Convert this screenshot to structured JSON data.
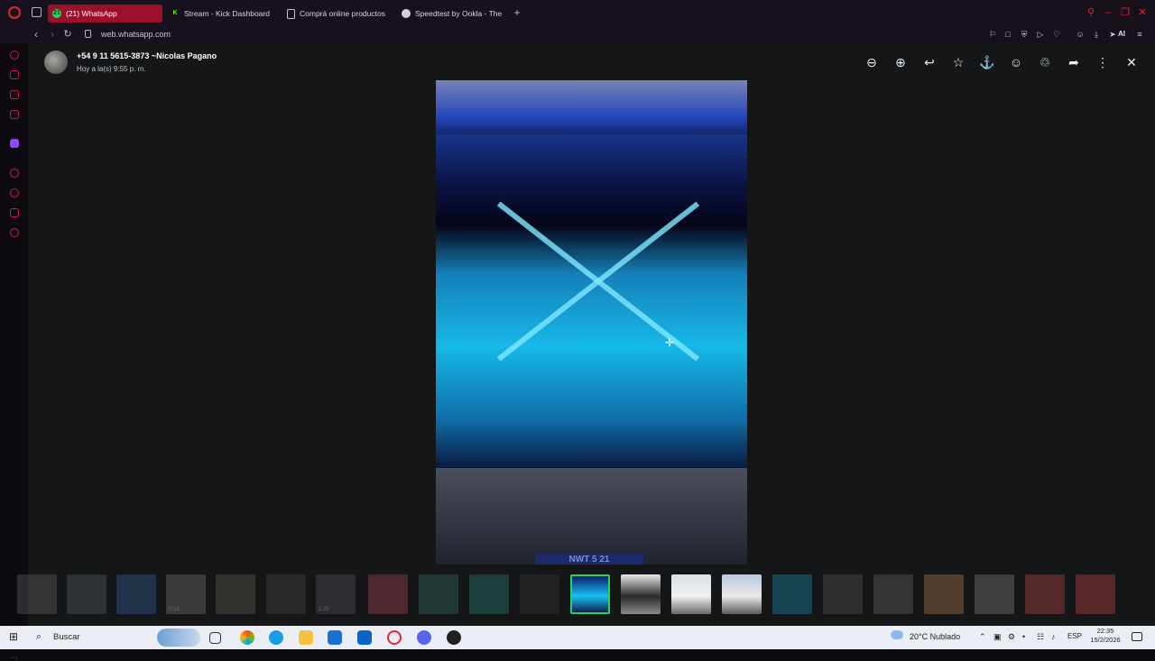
{
  "browser": {
    "tabs": [
      {
        "label": "(21) WhatsApp",
        "icon": "whatsapp-icon",
        "badge": "21",
        "active": true
      },
      {
        "label": "Stream - Kick Dashboard",
        "icon": "kick-icon",
        "active": false
      },
      {
        "label": "Comprá online productos",
        "icon": "page-icon",
        "active": false
      },
      {
        "label": "Speedtest by Ookla - The",
        "icon": "github-icon",
        "active": false
      }
    ],
    "new_tab": "+",
    "url": "web.whatsapp.com",
    "ai_label": "AI",
    "accent": "#e0243a"
  },
  "viewer": {
    "contact_name": "+54 9 11 5615-3873 ~Nicolas Pagano",
    "timestamp": "Hoy a la(s) 9:55 p. m.",
    "toolbar": [
      "zoom-out",
      "zoom-in",
      "reply",
      "star",
      "pin",
      "react",
      "delete",
      "forward",
      "more",
      "close"
    ],
    "photo_plate": "NWT 5 21",
    "selected_thumb": 11
  },
  "taskbar": {
    "search_placeholder": "Buscar",
    "weather": "20°C Nublado",
    "language": "ESP",
    "time": "22:35",
    "date": "15/2/2026",
    "thumb_labels": [
      "0:18",
      "1:25"
    ]
  }
}
